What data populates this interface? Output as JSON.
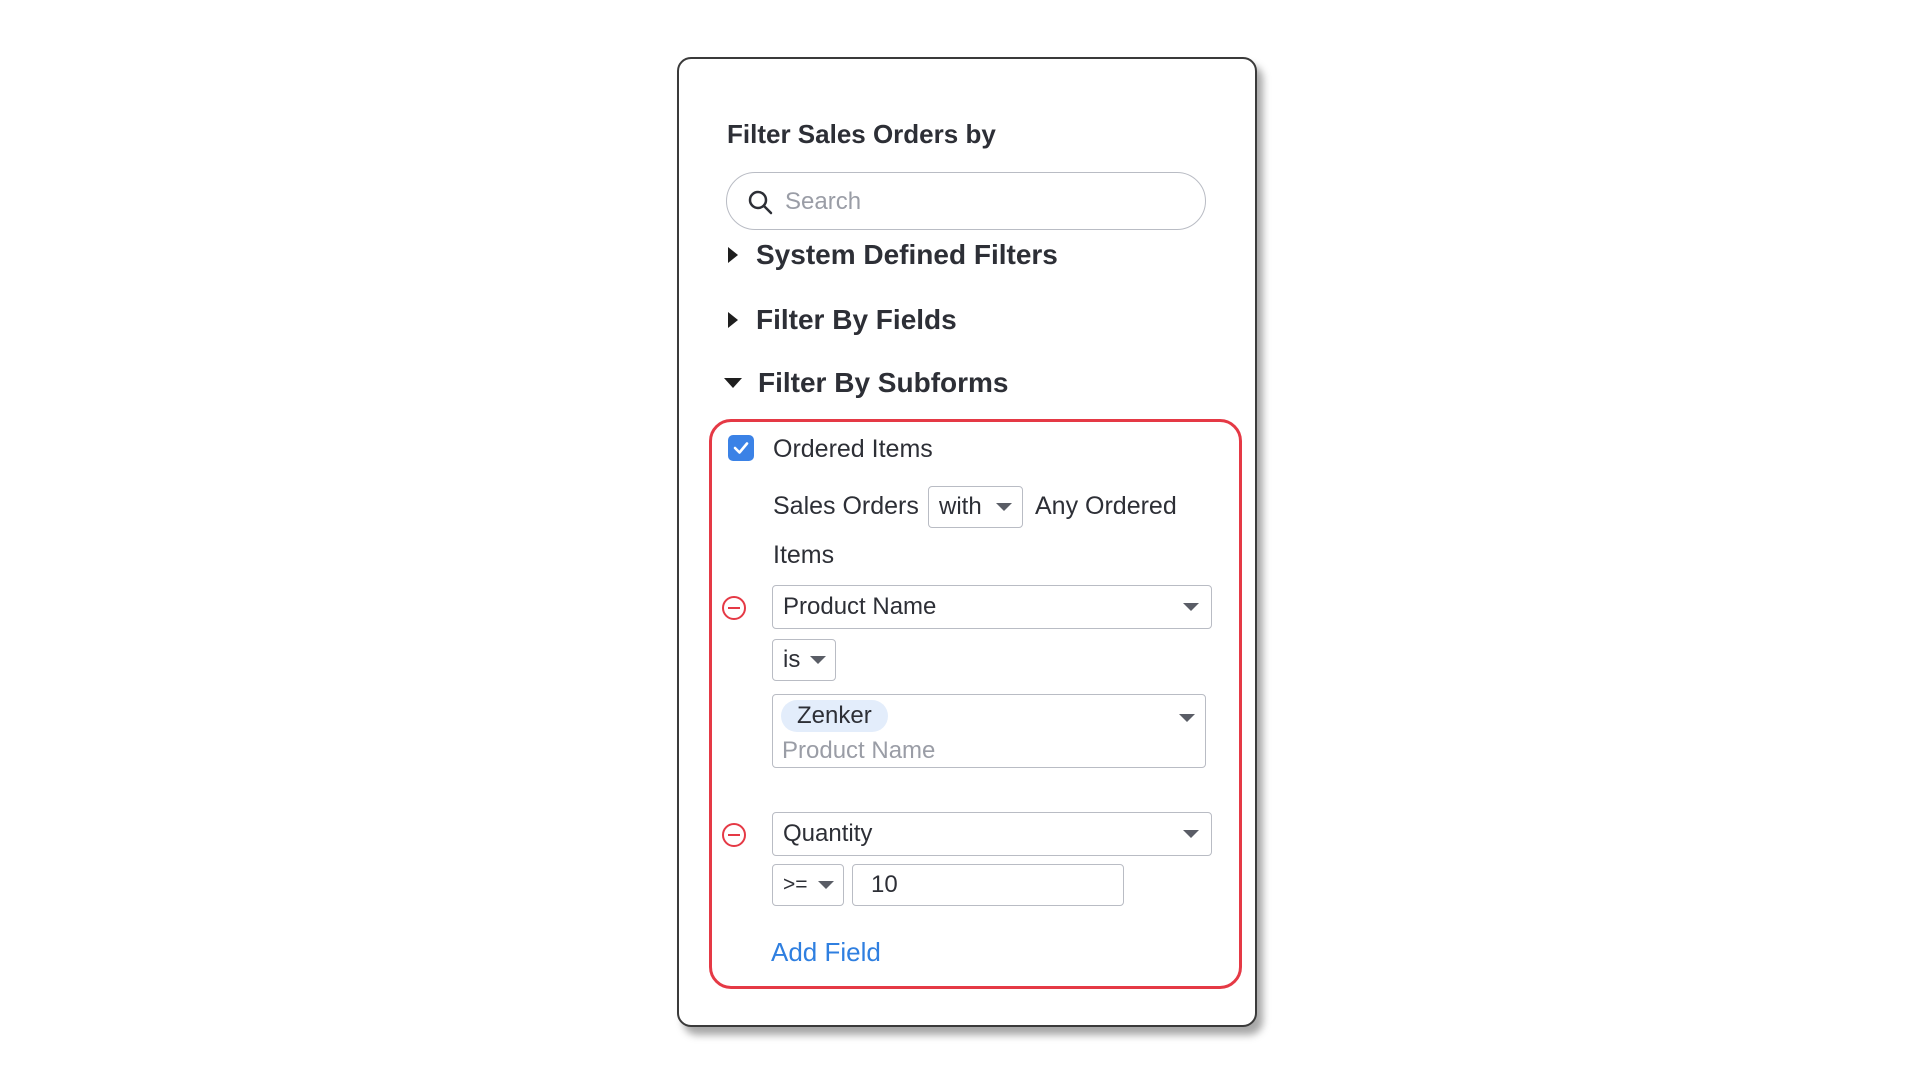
{
  "panel": {
    "title": "Filter Sales Orders by",
    "search": {
      "placeholder": "Search",
      "value": "",
      "icon": "search-icon"
    },
    "sections": [
      {
        "label": "System Defined Filters",
        "expanded": false
      },
      {
        "label": "Filter By Fields",
        "expanded": false
      },
      {
        "label": "Filter By Subforms",
        "expanded": true
      }
    ]
  },
  "subform": {
    "checkbox_label": "Ordered Items",
    "checked": true,
    "sentence_prefix": "Sales Orders",
    "with_option": "with",
    "sentence_suffix_line1": "Any Ordered",
    "sentence_suffix_line2": "Items",
    "conditions": [
      {
        "field": "Product Name",
        "operator": "is",
        "chips": [
          "Zenker"
        ],
        "value_placeholder": "Product Name"
      },
      {
        "field": "Quantity",
        "operator": ">=",
        "value": "10"
      }
    ],
    "add_field_label": "Add Field"
  },
  "colors": {
    "accent": "#3b82e6",
    "link": "#2f7fe0",
    "highlight": "#e53945",
    "remove": "#e53945"
  }
}
